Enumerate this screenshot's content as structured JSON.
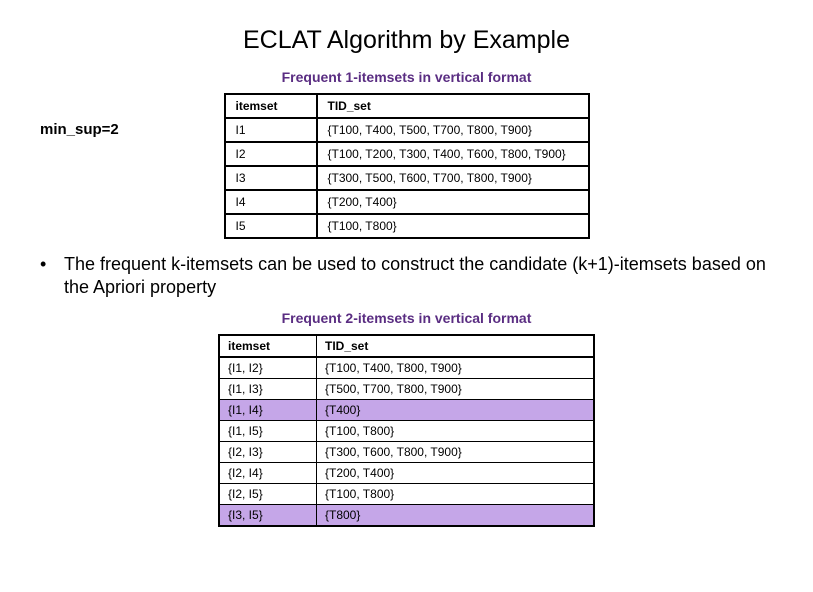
{
  "title": "ECLAT Algorithm by Example",
  "subtitle1": "Frequent 1-itemsets in vertical format",
  "min_sup_label": "min_sup=2",
  "table1_headers": {
    "itemset": "itemset",
    "tid_set": "TID_set"
  },
  "table1_rows": [
    {
      "itemset": "I1",
      "tid_set": "{T100, T400, T500, T700, T800, T900}"
    },
    {
      "itemset": "I2",
      "tid_set": "{T100, T200, T300, T400, T600, T800, T900}"
    },
    {
      "itemset": "I3",
      "tid_set": "{T300, T500, T600, T700, T800, T900}"
    },
    {
      "itemset": "I4",
      "tid_set": "{T200, T400}"
    },
    {
      "itemset": "I5",
      "tid_set": "{T100, T800}"
    }
  ],
  "bullet_text": "The frequent k-itemsets can be used to construct the candidate (k+1)-itemsets based on the Apriori property",
  "subtitle2": "Frequent 2-itemsets in vertical format",
  "table2_headers": {
    "itemset": "itemset",
    "tid_set": "TID_set"
  },
  "table2_rows": [
    {
      "itemset": "{I1, I2}",
      "tid_set": "{T100, T400, T800, T900}",
      "hl": false
    },
    {
      "itemset": "{I1, I3}",
      "tid_set": "{T500, T700, T800, T900}",
      "hl": false
    },
    {
      "itemset": "{I1, I4}",
      "tid_set": "{T400}",
      "hl": true
    },
    {
      "itemset": "{I1, I5}",
      "tid_set": "{T100, T800}",
      "hl": false
    },
    {
      "itemset": "{I2, I3}",
      "tid_set": "{T300, T600, T800, T900}",
      "hl": false
    },
    {
      "itemset": "{I2, I4}",
      "tid_set": "{T200, T400}",
      "hl": false
    },
    {
      "itemset": "{I2, I5}",
      "tid_set": "{T100, T800}",
      "hl": false
    },
    {
      "itemset": "{I3, I5}",
      "tid_set": "{T800}",
      "hl": true
    }
  ]
}
